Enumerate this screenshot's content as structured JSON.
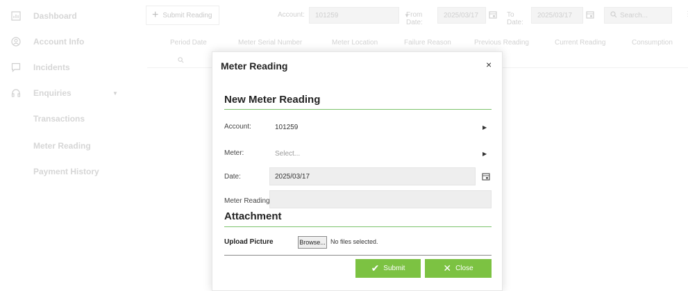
{
  "sidebar": {
    "items": [
      {
        "label": "Dashboard",
        "icon": "dashboard-icon"
      },
      {
        "label": "Account Info",
        "icon": "account-icon"
      },
      {
        "label": "Incidents",
        "icon": "incidents-icon"
      },
      {
        "label": "Enquiries",
        "icon": "headset-icon"
      },
      {
        "label": "Transactions"
      },
      {
        "label": "Meter Reading"
      },
      {
        "label": "Payment History"
      }
    ]
  },
  "toolbar": {
    "submit_reading_label": "Submit Reading",
    "account_label": "Account:",
    "account_value": "101259",
    "from_date_label": "From Date:",
    "from_date_value": "2025/03/17",
    "to_date_label": "To Date:",
    "to_date_value": "2025/03/17",
    "search_placeholder": "Search..."
  },
  "table": {
    "columns": [
      "Period Date",
      "Meter Serial Number",
      "Meter Location",
      "Failure Reason",
      "Previous Reading",
      "Current Reading",
      "Consumption"
    ]
  },
  "modal": {
    "title": "Meter Reading",
    "close_glyph": "×",
    "section_new": "New Meter Reading",
    "account_label": "Account:",
    "account_value": "101259",
    "meter_label": "Meter:",
    "meter_placeholder": "Select...",
    "date_label": "Date:",
    "date_value": "2025/03/17",
    "reading_label": "Meter Reading:",
    "section_attachment": "Attachment",
    "upload_label": "Upload Picture",
    "browse_label": "Browse...",
    "no_files": "No files selected.",
    "submit_label": "Submit",
    "close_label": "Close"
  },
  "colors": {
    "accent_green": "#7cc242",
    "section_line": "#7cc36b"
  }
}
